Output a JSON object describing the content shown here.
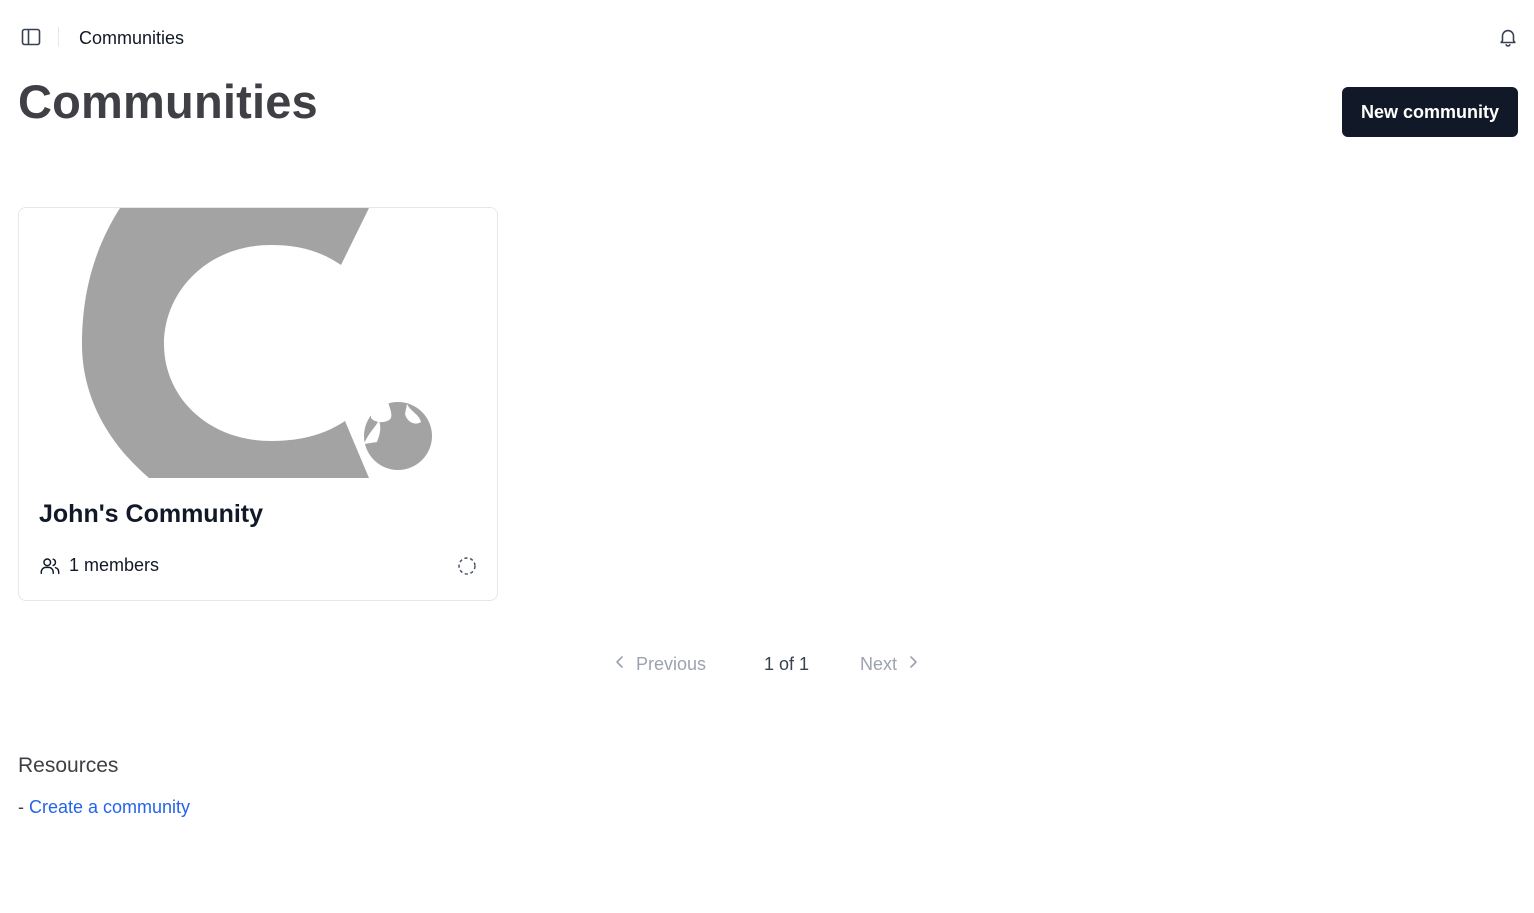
{
  "topbar": {
    "breadcrumb": "Communities",
    "sidebar_toggle_icon": "sidebar-panel-icon",
    "notifications_icon": "bell-icon"
  },
  "header": {
    "title": "Communities",
    "new_button_label": "New community"
  },
  "communities": [
    {
      "name": "John's Community",
      "members_label": "1 members",
      "members_icon": "users-icon",
      "status_icon": "dashed-circle-icon",
      "image_icon": "community-logo"
    }
  ],
  "pagination": {
    "previous_label": "Previous",
    "page_info": "1 of 1",
    "next_label": "Next"
  },
  "resources": {
    "title": "Resources",
    "items": [
      {
        "prefix": "- ",
        "label": "Create a community"
      }
    ]
  },
  "colors": {
    "primary_button": "#111827",
    "link": "#2563eb",
    "placeholder_logo": "#a3a3a3",
    "muted_text": "#9ca3af"
  }
}
